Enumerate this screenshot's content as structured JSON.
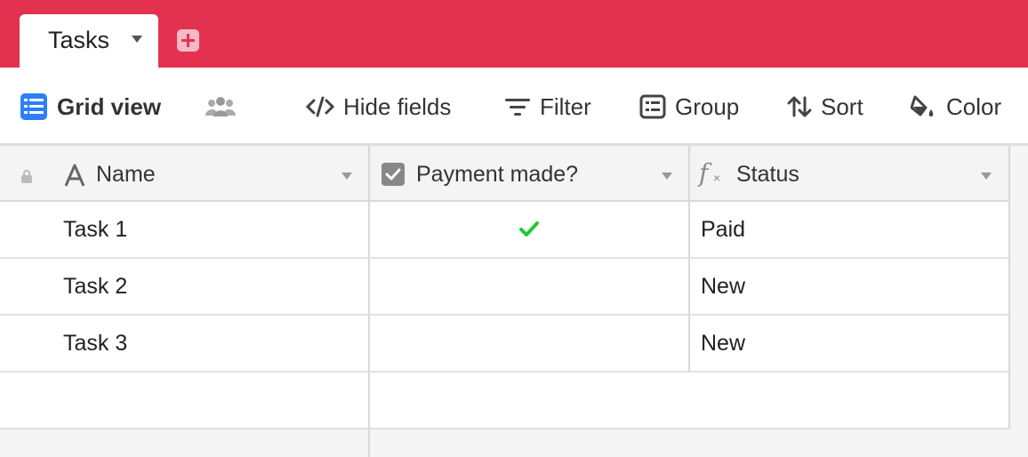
{
  "tabs": {
    "active_label": "Tasks"
  },
  "toolbar": {
    "view_name": "Grid view",
    "hide_fields": "Hide fields",
    "filter": "Filter",
    "group": "Group",
    "sort": "Sort",
    "color": "Color"
  },
  "columns": [
    {
      "label": "Name",
      "icon": "text-field-icon"
    },
    {
      "label": "Payment made?",
      "icon": "checkbox-field-icon"
    },
    {
      "label": "Status",
      "icon": "formula-field-icon"
    }
  ],
  "rows": [
    {
      "name": "Task 1",
      "payment_made": true,
      "status": "Paid"
    },
    {
      "name": "Task 2",
      "payment_made": false,
      "status": "New"
    },
    {
      "name": "Task 3",
      "payment_made": false,
      "status": "New"
    }
  ],
  "colors": {
    "brand": "#e3324f",
    "check": "#20c933",
    "view_icon": "#2d7ff9"
  }
}
